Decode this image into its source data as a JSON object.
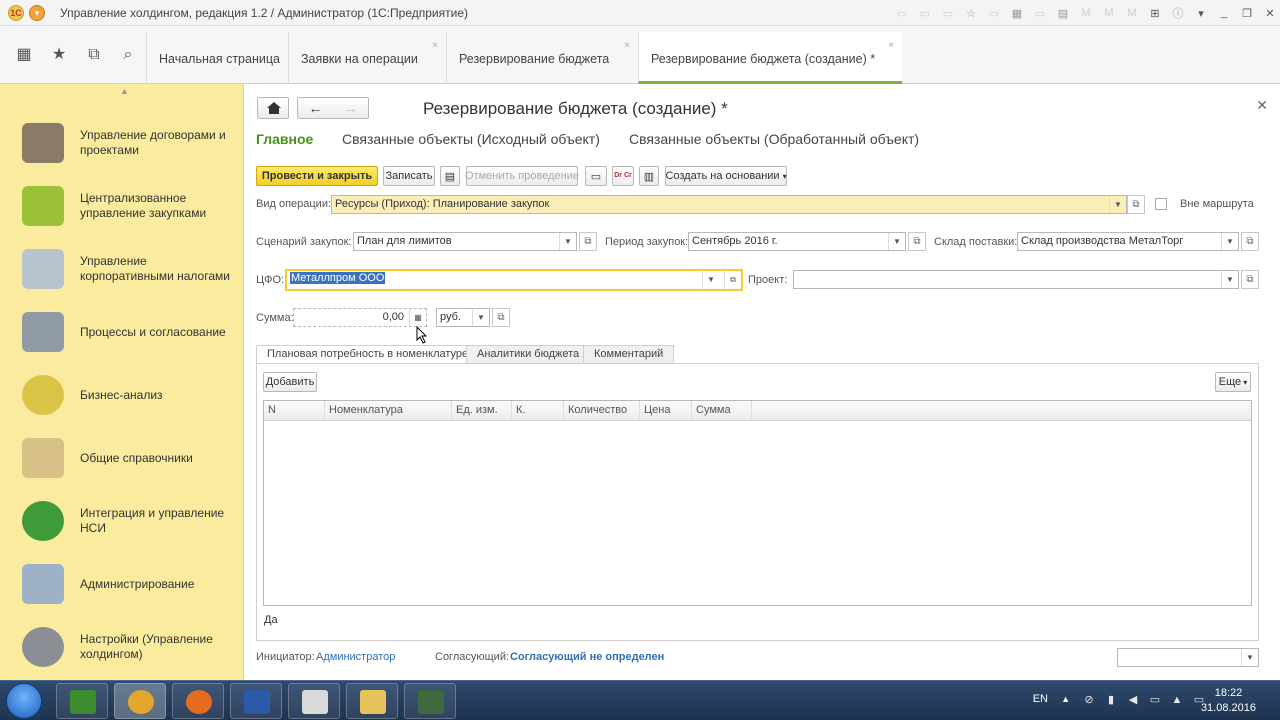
{
  "window": {
    "title": "Управление холдингом, редакция 1.2 / Администратор (1С:Предприятие)",
    "logo_text": "1С",
    "menu_icon": "menu-icon"
  },
  "nav_tabs": [
    {
      "label": "Начальная страница",
      "closable": false,
      "active": false
    },
    {
      "label": "Заявки на операции",
      "closable": true,
      "active": false
    },
    {
      "label": "Резервирование бюджета",
      "closable": true,
      "active": false
    },
    {
      "label": "Резервирование бюджета (создание) *",
      "closable": true,
      "active": true
    }
  ],
  "close_glyph": "×",
  "sidebar": {
    "items": [
      {
        "label": "Управление договорами и проектами",
        "icon": "briefcase-icon",
        "color": "#8a7b68"
      },
      {
        "label": "Централизованное управление закупками",
        "icon": "gift-box-icon",
        "color": "#9cc23a"
      },
      {
        "label": "Управление корпоративными налогами",
        "icon": "documents-icon",
        "color": "#b8c4cf"
      },
      {
        "label": "Процессы и согласование",
        "icon": "process-icon",
        "color": "#8f9aa5"
      },
      {
        "label": "Бизнес-анализ",
        "icon": "pie-chart-icon",
        "color": "#d9c445"
      },
      {
        "label": "Общие справочники",
        "icon": "book-icon",
        "color": "#d8c186"
      },
      {
        "label": "Интеграция и управление НСИ",
        "icon": "sync-icon",
        "color": "#3f9a3a"
      },
      {
        "label": "Администрирование",
        "icon": "computer-icon",
        "color": "#9db2c9"
      },
      {
        "label": "Настройки (Управление холдингом)",
        "icon": "gears-icon",
        "color": "#8b8f95"
      }
    ]
  },
  "form": {
    "title": "Резервирование бюджета (создание) *",
    "sections": [
      "Главное",
      "Связанные объекты (Исходный объект)",
      "Связанные объекты (Обработанный объект)"
    ],
    "toolbar": {
      "post_close": "Провести и закрыть",
      "save": "Записать",
      "cancel_post": "Отменить проведение",
      "create_basis": "Создать на основании",
      "dtct": "Dr Cr"
    },
    "fields": {
      "op_type_label": "Вид операции:",
      "op_type_value": "Ресурсы (Приход): Планирование закупок",
      "out_of_route_label": "Вне маршрута",
      "scenario_label": "Сценарий закупок:",
      "scenario_value": "План для лимитов",
      "period_label": "Период закупок:",
      "period_value": "Сентябрь 2016 г.",
      "warehouse_label": "Склад поставки:",
      "warehouse_value": "Склад производства МеталТорг",
      "cfo_label": "ЦФО:",
      "cfo_value": "Металлпром ООО",
      "project_label": "Проект:",
      "project_value": "",
      "amount_label": "Сумма:",
      "amount_value": "0,00",
      "currency_value": "руб."
    },
    "inner_tabs": [
      "Плановая потребность в номенклатуре",
      "Аналитики бюджета",
      "Комментарий"
    ],
    "add_button": "Добавить",
    "more_button": "Еще",
    "table_columns": [
      "N",
      "Номенклатура",
      "Ед. изм.",
      "К.",
      "Количество",
      "Цена",
      "Сумма"
    ],
    "footer_value": "Да",
    "initiator_label": "Инициатор:",
    "initiator_value": "Администратор",
    "approver_label": "Согласующий:",
    "approver_value": "Согласующий не определен"
  },
  "taskbar": {
    "apps": [
      {
        "icon": "tree-app-icon",
        "color": "#3c8d2f"
      },
      {
        "icon": "1c-enterprise-icon",
        "color": "#e2a72c",
        "active": true
      },
      {
        "icon": "firefox-icon",
        "color": "#e56b1f"
      },
      {
        "icon": "word-icon",
        "color": "#2a5aa8"
      },
      {
        "icon": "paint-icon",
        "color": "#d9d9d9"
      },
      {
        "icon": "explorer-icon",
        "color": "#e8c25a"
      },
      {
        "icon": "terminal-icon",
        "color": "#3e6a3e"
      }
    ],
    "language": "EN",
    "time": "18:22",
    "date": "31.08.2016"
  },
  "colors": {
    "sidebar_bg": "#fbeb9e",
    "active_tab": "#7bb33f",
    "primary_button": "#f3cf26",
    "link": "#2f6fb5"
  }
}
